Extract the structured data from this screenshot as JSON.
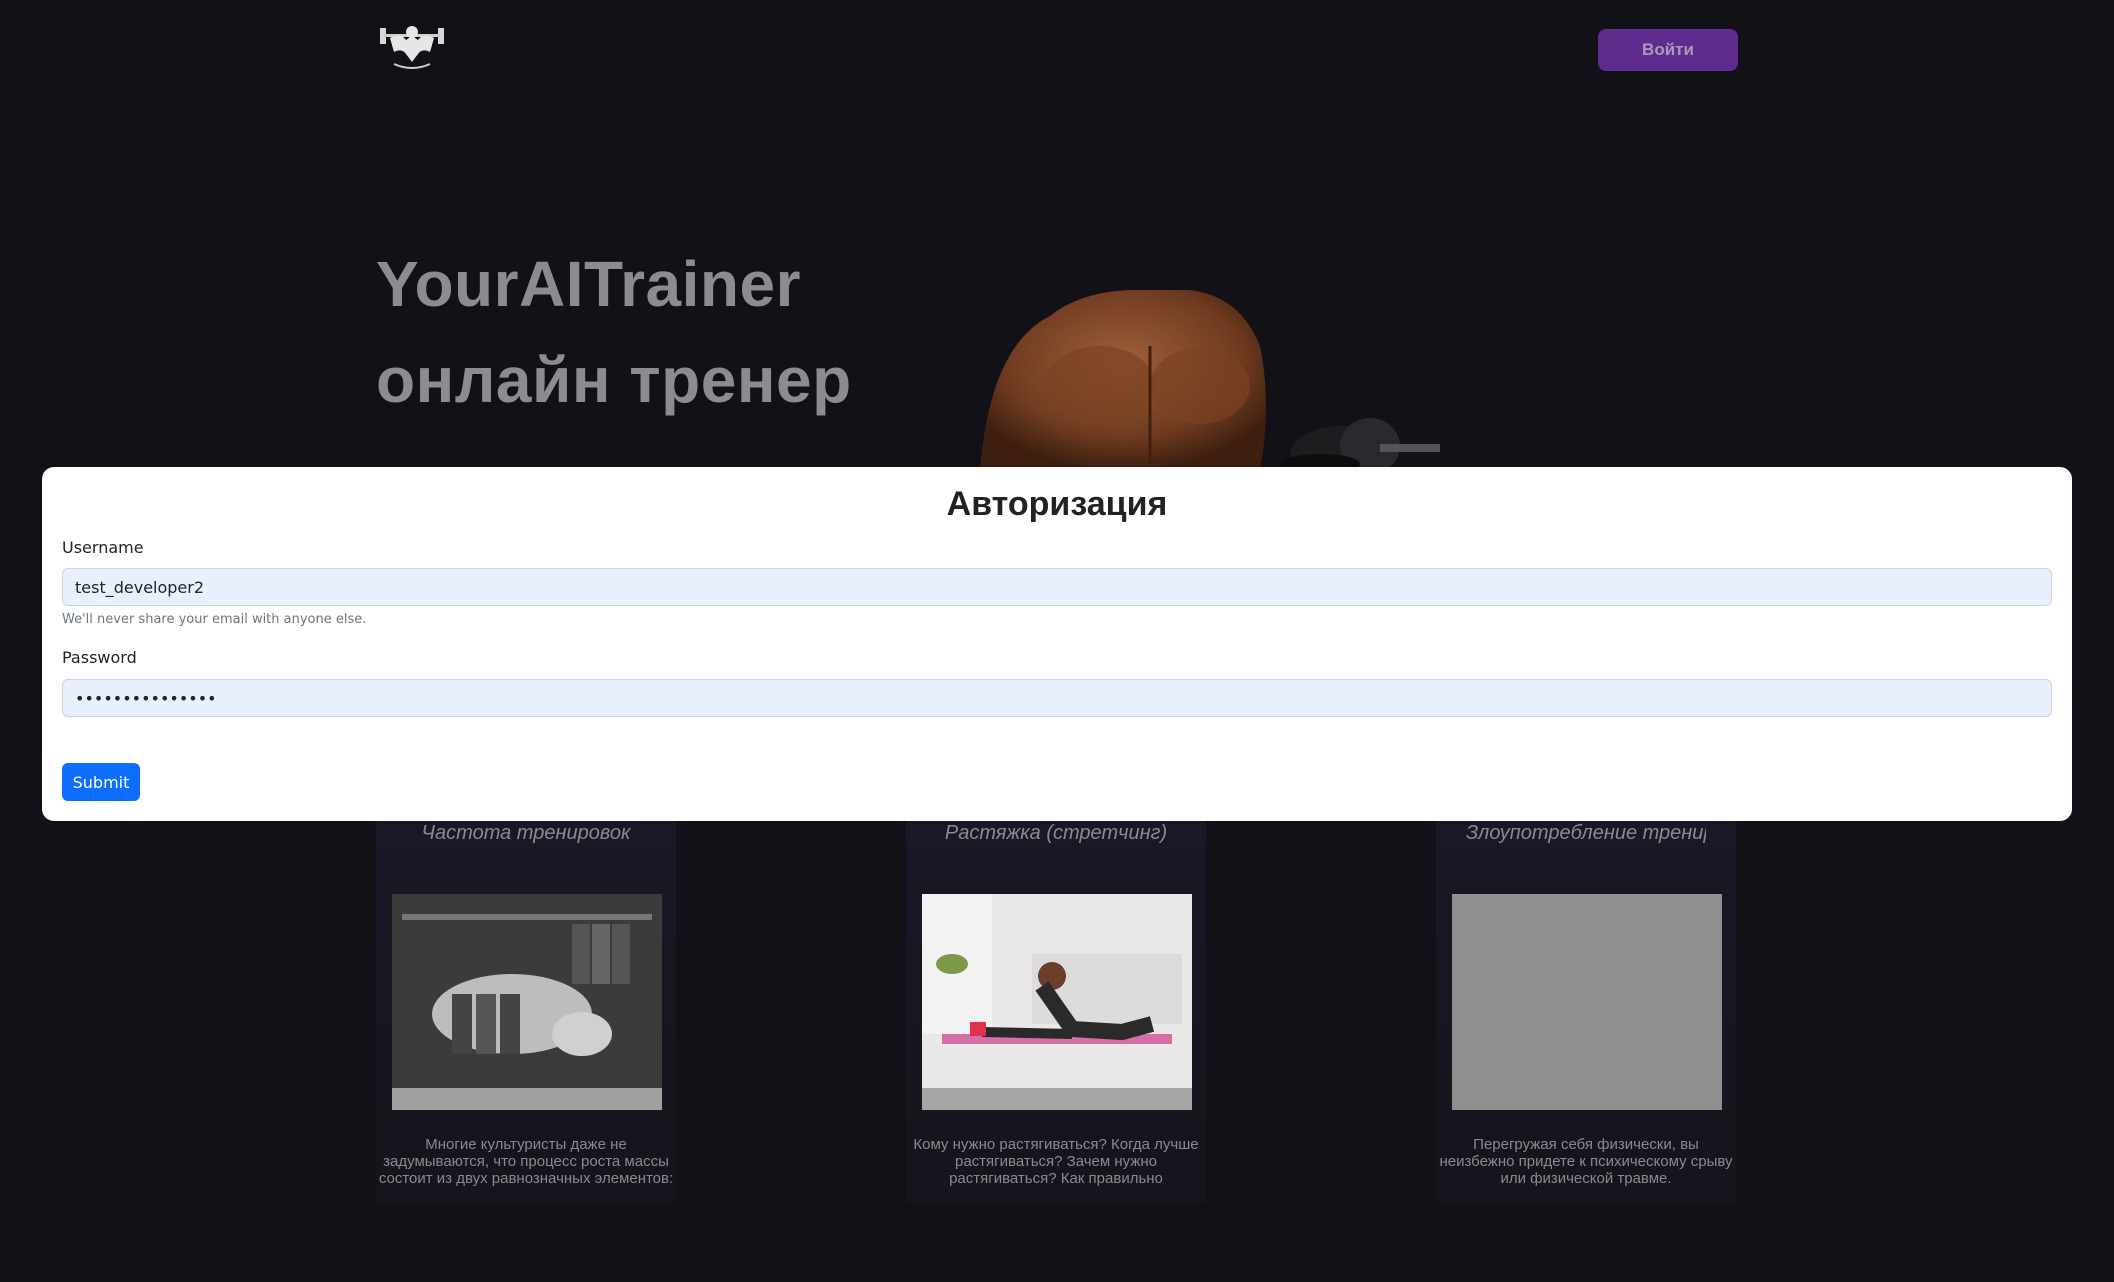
{
  "header": {
    "logo_icon": "bodybuilder-logo-icon",
    "login_label": "Войти",
    "login_color": "#5e2b8f"
  },
  "hero": {
    "title_line1": "YourAITrainer",
    "title_line2": "онлайн тренер",
    "image_icon": "muscular-man-dumbbell-image"
  },
  "cards": [
    {
      "title": "Частота тренировок",
      "image": "bodybuilder-dumbbell-bench-photo",
      "text": "Многие культуристы даже не задумываются, что процесс роста массы состоит из двух равнозначных элементов:"
    },
    {
      "title": "Растяжка (стретчинг)",
      "image": "woman-stretching-photo",
      "text": "Кому нужно растягиваться? Когда лучше растягиваться? Зачем нужно растягиваться? Как правильно"
    },
    {
      "title": "Злоупотребление тренировками",
      "image": "placeholder-gray-image",
      "text": "Перегружая себя физически, вы неизбежно придете к психическому срыву или физической травме."
    }
  ],
  "modal": {
    "title": "Авторизация",
    "username_label": "Username",
    "username_value": "test_developer2",
    "help_text": "We'll never share your email with anyone else.",
    "password_label": "Password",
    "password_value": "•••••••••••••••",
    "submit_label": "Submit",
    "submit_color": "#0d6efd"
  }
}
